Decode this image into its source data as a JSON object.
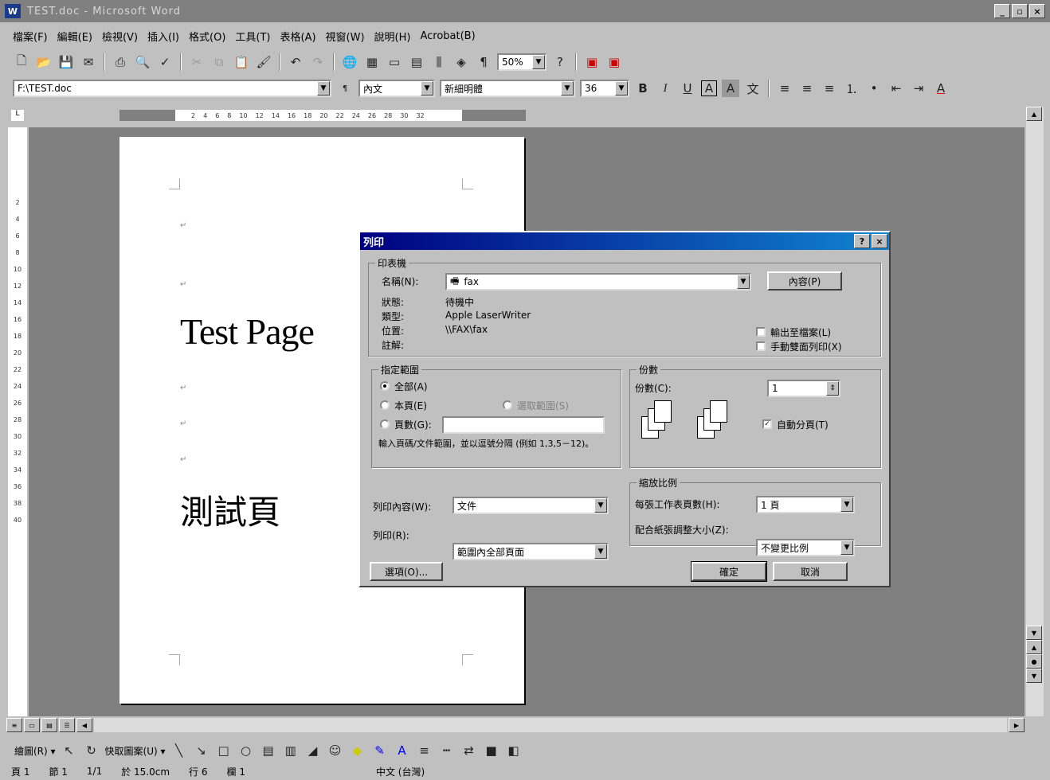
{
  "window": {
    "title": "TEST.doc - Microsoft Word",
    "app_icon": "W"
  },
  "window_buttons": [
    "_",
    "▫",
    "×"
  ],
  "menu": [
    "檔案(F)",
    "編輯(E)",
    "檢視(V)",
    "插入(I)",
    "格式(O)",
    "工具(T)",
    "表格(A)",
    "視窗(W)",
    "說明(H)",
    "Acrobat(B)"
  ],
  "toolbar": {
    "zoom": "50%"
  },
  "format": {
    "file_box": "F:\\TEST.doc",
    "style": "內文",
    "font": "新細明體",
    "size": "36"
  },
  "document": {
    "text_en": "Test Page",
    "text_cjk": "測試頁"
  },
  "status": {
    "page": "頁 1",
    "section": "節 1",
    "pages": "1/1",
    "at": "於 15.0cm",
    "line": "行 6",
    "col": "欄 1",
    "lang": "中文 (台灣)"
  },
  "draw": {
    "draw_label": "繪圖(R) ▾",
    "autoshape_label": "快取圖案(U) ▾"
  },
  "dialog": {
    "title": "列印",
    "help": "?",
    "close": "×",
    "printer_group": "印表機",
    "name_label": "名稱(N):",
    "name_value": "fax",
    "properties_btn": "內容(P)",
    "status_label": "狀態:",
    "status_value": "待機中",
    "type_label": "類型:",
    "type_value": "Apple LaserWriter",
    "where_label": "位置:",
    "where_value": "\\\\FAX\\fax",
    "comment_label": "註解:",
    "print_to_file": "輸出至檔案(L)",
    "manual_duplex": "手動雙面列印(X)",
    "range_group": "指定範圍",
    "range_all": "全部(A)",
    "range_current": "本頁(E)",
    "range_selection": "選取範圍(S)",
    "range_pages": "頁數(G):",
    "range_hint": "輸入頁碼/文件範圍，並以逗號分隔 (例如 1,3,5－12)。",
    "copies_group": "份數",
    "copies_label": "份數(C):",
    "copies_value": "1",
    "collate": "自動分頁(T)",
    "zoom_group": "縮放比例",
    "pages_per_sheet_label": "每張工作表頁數(H):",
    "pages_per_sheet_value": "1 頁",
    "scale_label": "配合紙張調整大小(Z):",
    "scale_value": "不變更比例",
    "print_what_label": "列印內容(W):",
    "print_what_value": "文件",
    "print_label": "列印(R):",
    "print_value": "範圍內全部頁面",
    "options_btn": "選項(O)...",
    "ok_btn": "確定",
    "cancel_btn": "取消"
  }
}
